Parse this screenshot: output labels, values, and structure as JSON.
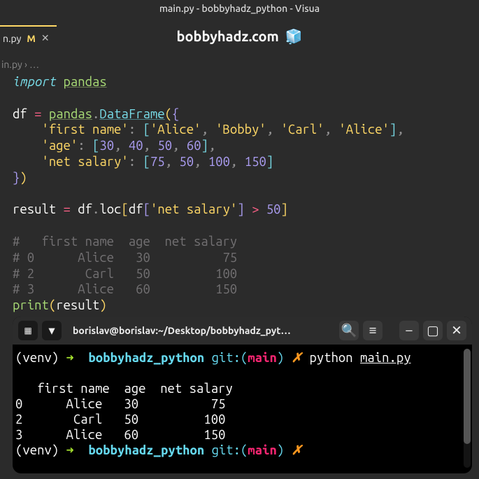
{
  "window_title": "main.py - bobbyhadz_python - Visua",
  "tab": {
    "name": "n.py",
    "git_marker": "M"
  },
  "watermark": {
    "text": "bobbyhadz.com",
    "cube": "🧊"
  },
  "breadcrumb": {
    "file": "in.py",
    "sep": "›",
    "more": "…"
  },
  "code": {
    "l1_import": "import",
    "l1_pandas": "pandas",
    "l3_df": "df",
    "l3_eq": "=",
    "l3_pandas": "pandas",
    "l3_dot": ".",
    "l3_DataFrame": "DataFrame",
    "l4_key": "'first name'",
    "l4_vals": [
      "'Alice'",
      "'Bobby'",
      "'Carl'",
      "'Alice'"
    ],
    "l5_key": "'age'",
    "l5_vals": [
      "30",
      "40",
      "50",
      "60"
    ],
    "l6_key": "'net salary'",
    "l6_vals": [
      "75",
      "50",
      "100",
      "150"
    ],
    "l9_result": "result",
    "l9_eq": "=",
    "l9_df": "df",
    "l9_loc": "loc",
    "l9_df2": "df",
    "l9_key": "'net salary'",
    "l9_gt": ">",
    "l9_fifty": "50",
    "comment1": "#   first name  age  net salary",
    "comment2": "# 0      Alice   30          75",
    "comment3": "# 2       Carl   50         100",
    "comment4": "# 3      Alice   60         150",
    "print": "print",
    "print_arg": "result"
  },
  "terminal": {
    "title": "borislav@borislav:~/Desktop/bobbyhadz_pyt…",
    "venv": "(venv)",
    "arrow": "➜",
    "cwd": "bobbyhadz_python",
    "git": "git:",
    "branch": "main",
    "x": "✗",
    "cmd_python": "python",
    "cmd_file": "main.py",
    "out1": "   first name  age  net salary",
    "out2": "0      Alice   30          75",
    "out3": "2       Carl   50         100",
    "out4": "3      Alice   60         150"
  },
  "icons": {
    "new_tab": "➕",
    "dropdown": "▾",
    "search": "🔍",
    "menu": "≡",
    "minimize": "–",
    "maximize": "▢",
    "close": "✕"
  }
}
